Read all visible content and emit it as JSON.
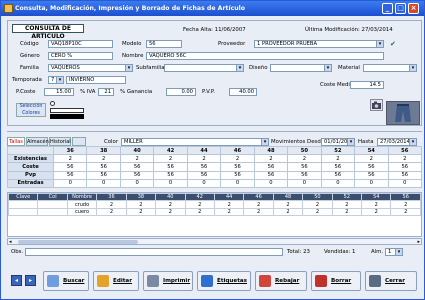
{
  "window": {
    "title": "Consulta, Modificación, Impresión y Borrado de Fichas de Artículo"
  },
  "header": {
    "badge": "CONSULTA DE ARTICULO",
    "fecha_alta_label": "Fecha Alta: 11/06/2007",
    "ultima_mod_label": "Última Modificación: 27/03/2014",
    "codigo_label": "Código",
    "codigo_value": "VAQ18P10C",
    "modelo_label": "Modelo",
    "modelo_value": "56",
    "proveedor_label": "Proveedor",
    "proveedor_value": "1 PROVEEDOR PRUEBA",
    "genero_label": "Género",
    "genero_value": "CERO %",
    "nombre_label": "Nombre",
    "nombre_value": "VAQUERO 56C",
    "familia_label": "Familia",
    "familia_value": "VAQUEROS",
    "subfamilia_label": "Subfamilia",
    "subfamilia_value": "",
    "diseno_label": "Diseño",
    "diseno_value": "",
    "material_label": "Material",
    "material_value": "",
    "temporada_label": "Temporada",
    "temporada_code": "7",
    "temporada_value": "INVIERNO",
    "coste_medio_label": "Coste Medio",
    "coste_medio_value": "14.5",
    "pcoste_label": "P.Coste",
    "pcoste_value": "15.00",
    "iva_label": "% IVA",
    "iva_value": "21",
    "ganancia_label": "% Ganancia",
    "ganancia_value": "0.00",
    "pvp_label": "P.V.P.",
    "pvp_value": "40.00",
    "seleccion_label": "Selección",
    "colores_label": "Colores"
  },
  "tabs": [
    "Tallas",
    "Almacén",
    "Historial"
  ],
  "filters": {
    "color_label": "Color",
    "color_value": "MILLER",
    "mov_label": "Movimientos Desde",
    "desde_value": "01/01/2013",
    "hasta_label": "Hasta",
    "hasta_value": "27/03/2014"
  },
  "grid_top": {
    "sizes": [
      "36",
      "38",
      "40",
      "42",
      "44",
      "46",
      "48",
      "50",
      "52",
      "54",
      "56"
    ],
    "rows": [
      {
        "label": "Existencias",
        "values": [
          "2",
          "2",
          "2",
          "2",
          "2",
          "2",
          "2",
          "2",
          "2",
          "2",
          "2"
        ]
      },
      {
        "label": "Coste",
        "values": [
          "56",
          "56",
          "56",
          "56",
          "56",
          "56",
          "56",
          "56",
          "56",
          "56",
          "56"
        ]
      },
      {
        "label": "Pvp",
        "values": [
          "56",
          "56",
          "56",
          "56",
          "56",
          "56",
          "56",
          "56",
          "56",
          "56",
          "56"
        ]
      },
      {
        "label": "Entradas",
        "values": [
          "0",
          "0",
          "0",
          "0",
          "0",
          "0",
          "0",
          "0",
          "0",
          "0",
          "0"
        ]
      }
    ]
  },
  "grid_bottom": {
    "headers": [
      "Clave",
      "Col",
      "Nombre",
      "36",
      "38",
      "40",
      "42",
      "44",
      "46",
      "48",
      "50",
      "52",
      "54",
      "56"
    ],
    "rows": [
      [
        "",
        "",
        "crudo",
        "2",
        "2",
        "2",
        "2",
        "2",
        "2",
        "2",
        "2",
        "2",
        "2",
        "2"
      ],
      [
        "",
        "",
        "cuero",
        "2",
        "2",
        "2",
        "2",
        "2",
        "2",
        "2",
        "2",
        "2",
        "2",
        "2"
      ]
    ]
  },
  "footer": {
    "obs_label": "Obs.",
    "total_label": "Total: 23",
    "vendidas_label": "Vendidas: 1",
    "alm_label": "Alm.",
    "alm_value": "1"
  },
  "toolbar": [
    "Buscar",
    "Editar",
    "Imprimir",
    "Etiquetas",
    "Rebajar",
    "Borrar",
    "Cerrar"
  ],
  "colors": {
    "title": "#1d4fd0",
    "accent": "#2a5bd7"
  }
}
